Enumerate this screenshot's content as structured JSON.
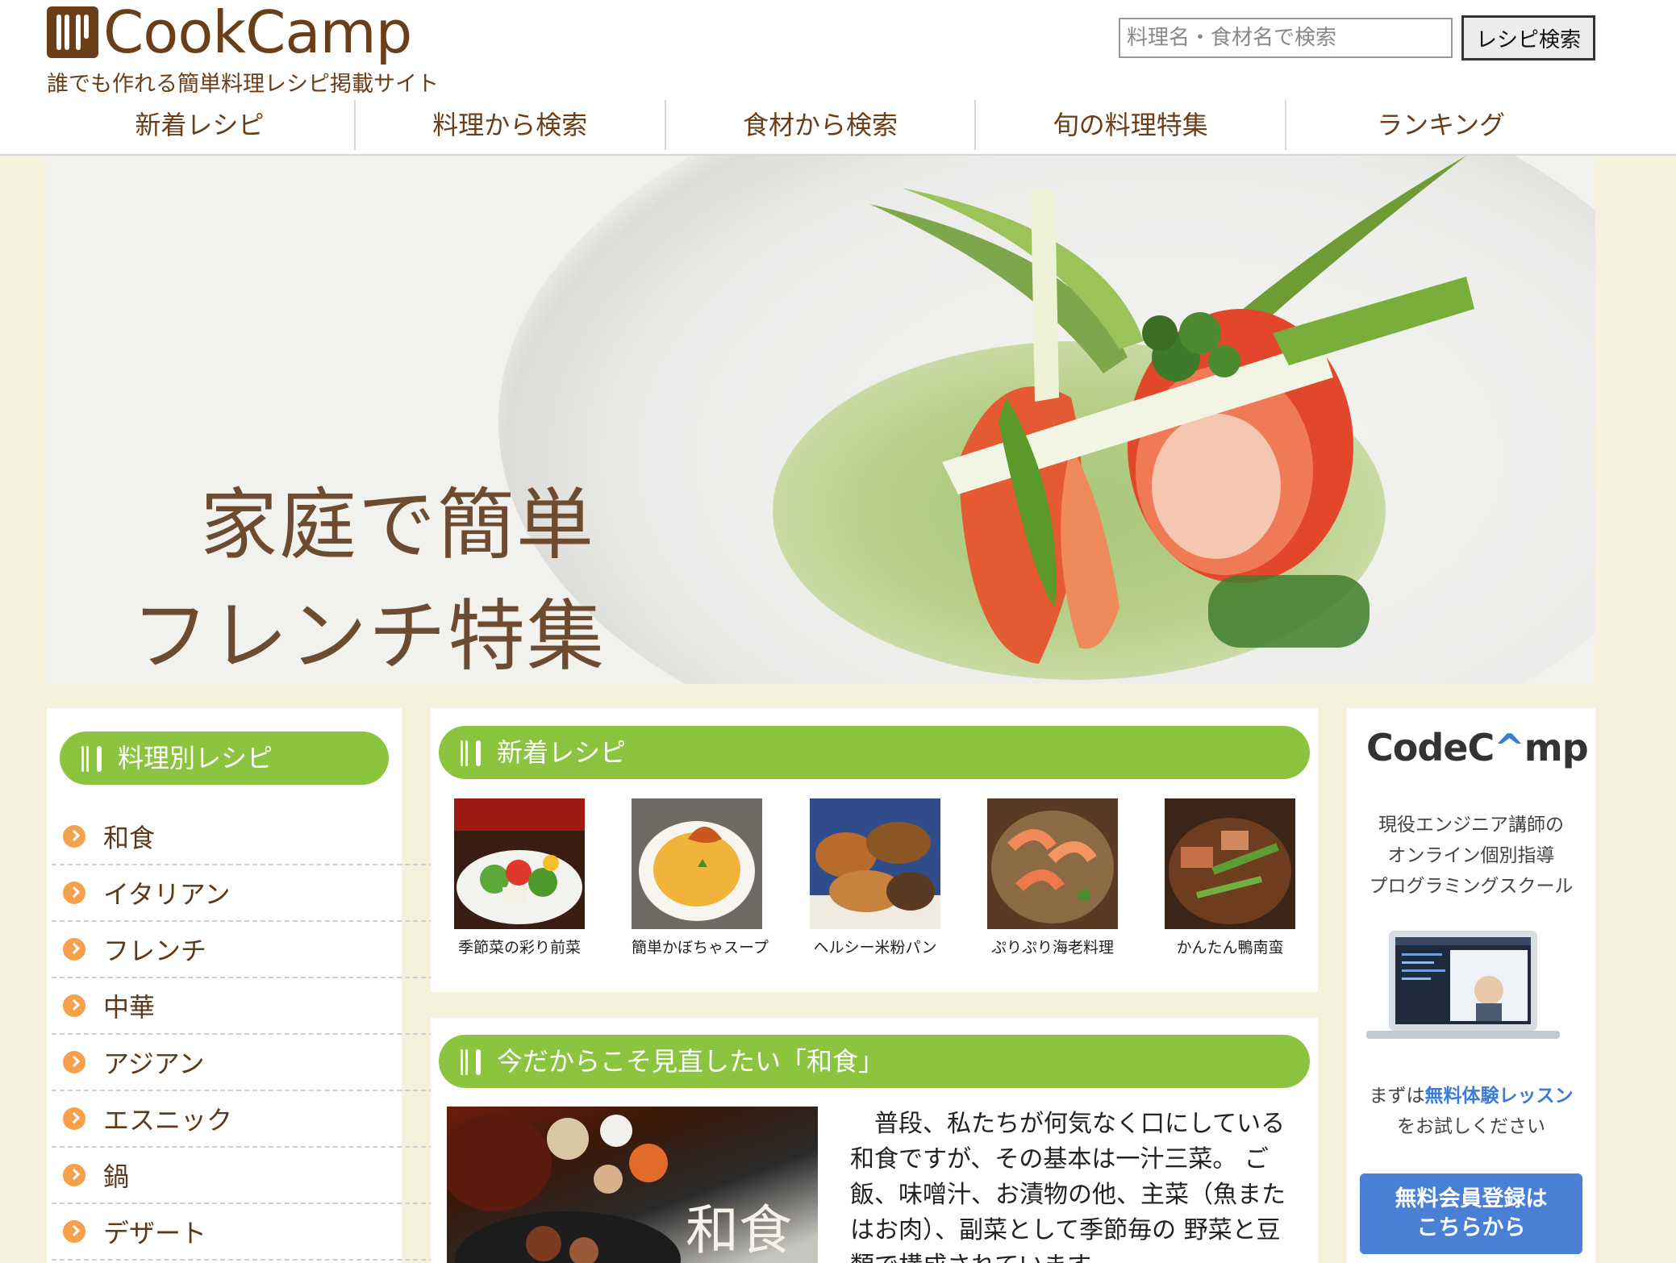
{
  "header": {
    "logo_text": "CookCamp",
    "tagline": "誰でも作れる簡単料理レシピ掲載サイト",
    "search_placeholder": "料理名・食材名で検索",
    "search_button": "レシピ検索"
  },
  "nav": [
    "新着レシピ",
    "料理から検索",
    "食材から検索",
    "旬の料理特集",
    "ランキング"
  ],
  "hero": {
    "line1": "家庭で簡単",
    "line2": "フレンチ特集"
  },
  "sidebar": {
    "heading": "料理別レシピ",
    "items": [
      "和食",
      "イタリアン",
      "フレンチ",
      "中華",
      "アジアン",
      "エスニック",
      "鍋",
      "デザート"
    ]
  },
  "new_recipes": {
    "heading": "新着レシピ",
    "items": [
      "季節菜の彩り前菜",
      "簡単かぼちゃスープ",
      "ヘルシー米粉パン",
      "ぷりぷり海老料理",
      "かんたん鴨南蛮"
    ]
  },
  "feature": {
    "heading": "今だからこそ見直したい「和食」",
    "image_label": "和食",
    "body": "普段、私たちが何気なく口にしている和食ですが、その基本は一汁三菜。 ご飯、味噌汁、お漬物の他、主菜（魚またはお肉）、副菜として季節毎の 野菜と豆類で構成されています。"
  },
  "ad": {
    "logo_prefix": "CodeC",
    "logo_hat": "^",
    "logo_suffix": "mp",
    "description_1": "現役エンジニア講師の",
    "description_2": "オンライン個別指導",
    "description_3": "プログラミングスクール",
    "trial_prefix": "まずは",
    "trial_highlight": "無料体験レッスン",
    "trial_suffix": "をお試しください",
    "register_line1": "無料会員登録は",
    "register_line2": "こちらから"
  },
  "colors": {
    "accent_green": "#8bc43f",
    "brown": "#6b3e1a",
    "page_bg": "#f4f2dc",
    "codecamp_blue": "#4a7fd6",
    "bullet_orange": "#f5a04a"
  }
}
